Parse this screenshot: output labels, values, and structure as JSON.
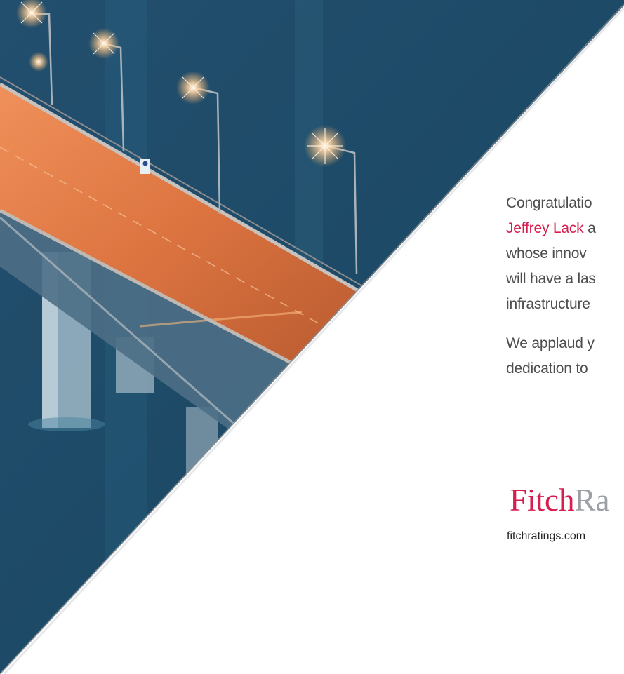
{
  "ad": {
    "body_lines": [
      {
        "accent": "",
        "text": "Congratulatio"
      },
      {
        "accent": "Jeffrey Lack",
        "text": " a"
      },
      {
        "accent": "",
        "text": "whose innov"
      },
      {
        "accent": "",
        "text": "will have a las"
      },
      {
        "accent": "",
        "text": "infrastructure"
      }
    ],
    "closing_lines": [
      "We applaud y",
      "dedication to"
    ],
    "logo_primary": "Fitch",
    "logo_secondary": "Ra",
    "url": "fitchratings.com"
  },
  "photo": {
    "subject": "illuminated bridge over water at dusk",
    "colors": {
      "water": "#1f4f6e",
      "deck": "#e07a3e",
      "accent": "#d61f4e",
      "text": "#4d4d4f"
    }
  }
}
